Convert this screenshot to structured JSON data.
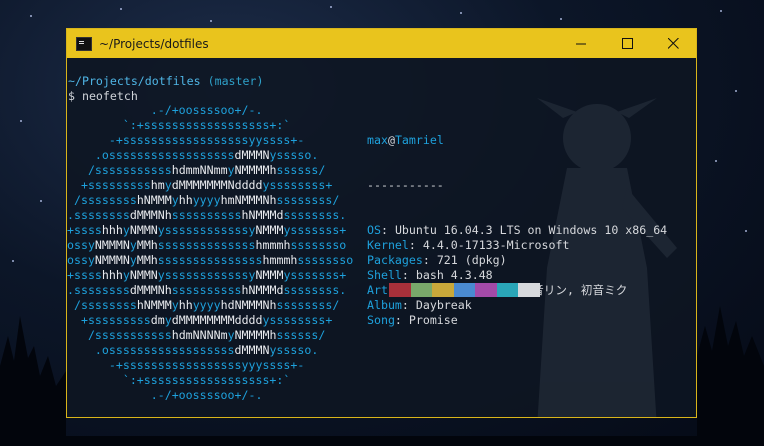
{
  "window": {
    "title": "~/Projects/dotfiles",
    "minimize_label": "—",
    "maximize_label": "☐",
    "close_label": "✕"
  },
  "prompt": {
    "path": "~/Projects/dotfiles",
    "branch": "(master)",
    "symbol": "$",
    "command": "neofetch"
  },
  "ascii_art": [
    "            .-/+oossssoo+/-.",
    "        `:+ssssssssssssssssss+:`",
    "      -+ssssssssssssssssssyyssss+-",
    "    .ossssssssssssssssssdMMMNysssso.",
    "   /ssssssssssshdmmNNmmyNMMMMhssssss/",
    "  +ssssssssshmydMMMMMMMNddddyssssssss+",
    " /sssssssshNMMMyhhyyyyhmNMMMNhssssssss/",
    ".ssssssssdMMMNhsssssssssshNMMMdssssssss.",
    "+sssshhhyNMMNyssssssssssssyNMMMysssssss+",
    "ossyNMMMNyMMhsssssssssssssshmmmhssssssso",
    "ossyNMMMNyMMhssssssssssssssshmmmhssssssso",
    "+sssshhhyNMMNyssssssssssssyNMMMysssssss+",
    ".ssssssssdMMMNhsssssssssshNMMMdssssssss.",
    " /sssssssshNMMMyhhyyyyhdNMMMNhssssssss/",
    "  +sssssssssdmydMMMMMMMMddddyssssssss+",
    "   /ssssssssssshdmNNNNmyNMMMMhssssss/",
    "    .ossssssssssssssssssdMMMNysssso.",
    "      -+sssssssssssssssssyyyssss+-",
    "        `:+ssssssssssssssssss+:`",
    "            .-/+oossssoo+/-."
  ],
  "info": {
    "user": "max",
    "at": "@",
    "host": "Tamriel",
    "separator": "-----------",
    "rows": [
      {
        "key": "OS",
        "value": "Ubuntu 16.04.3 LTS on Windows 10 x86_64"
      },
      {
        "key": "Kernel",
        "value": "4.4.0-17133-Microsoft"
      },
      {
        "key": "Packages",
        "value": "721 (dpkg)"
      },
      {
        "key": "Shell",
        "value": "bash 4.3.48"
      },
      {
        "key": "Artist",
        "value": "samfree feat. 鏡音リン, 初音ミク"
      },
      {
        "key": "Album",
        "value": "Daybreak"
      },
      {
        "key": "Song",
        "value": "Promise"
      }
    ]
  },
  "palette": [
    "#a8303a",
    "#79a86a",
    "#c8a83a",
    "#4a8ad0",
    "#a44aa8",
    "#2aa6b8",
    "#d6d8dc"
  ],
  "colors": {
    "titlebar": "#e9c41d",
    "accent_blue": "#1ea1dc",
    "text": "#d6d8dc"
  }
}
